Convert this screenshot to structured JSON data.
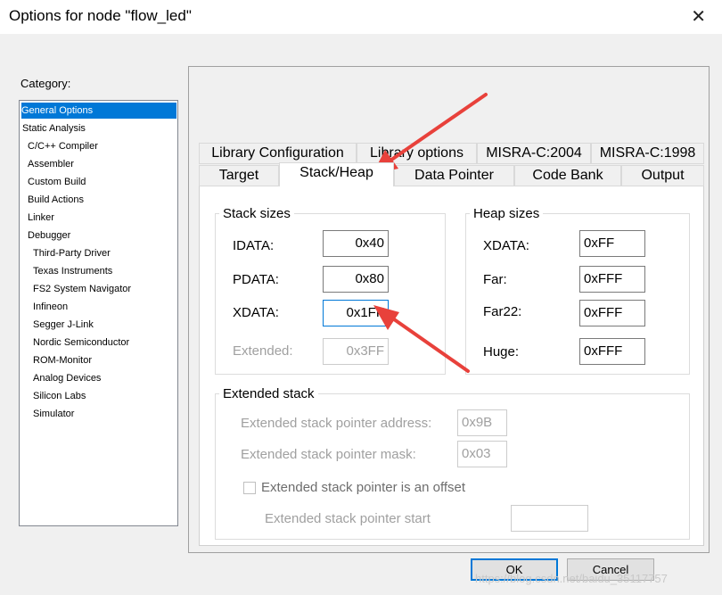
{
  "window": {
    "title": "Options for node \"flow_led\"",
    "close_glyph": "✕"
  },
  "category": {
    "label": "Category:",
    "items": [
      "General Options",
      "Static Analysis",
      "C/C++ Compiler",
      "Assembler",
      "Custom Build",
      "Build Actions",
      "Linker",
      "Debugger",
      "Third-Party Driver",
      "Texas Instruments",
      "FS2 System Navigator",
      "Infineon",
      "Segger J-Link",
      "Nordic Semiconductor",
      "ROM-Monitor",
      "Analog Devices",
      "Silicon Labs",
      "Simulator"
    ],
    "selected": "General Options"
  },
  "tabs": {
    "row1": [
      "Library Configuration",
      "Library options",
      "MISRA-C:2004",
      "MISRA-C:1998"
    ],
    "row2": [
      "Target",
      "Stack/Heap",
      "Data Pointer",
      "Code Bank",
      "Output"
    ],
    "active": "Stack/Heap"
  },
  "stack": {
    "title": "Stack sizes",
    "idata_label": "IDATA:",
    "idata_value": "0x40",
    "pdata_label": "PDATA:",
    "pdata_value": "0x80",
    "xdata_label": "XDATA:",
    "xdata_value": "0x1FF",
    "extended_label": "Extended:",
    "extended_value": "0x3FF"
  },
  "heap": {
    "title": "Heap sizes",
    "xdata_label": "XDATA:",
    "xdata_value": "0xFF",
    "far_label": "Far:",
    "far_value": "0xFFF",
    "far22_label": "Far22:",
    "far22_value": "0xFFF",
    "huge_label": "Huge:",
    "huge_value": "0xFFF"
  },
  "extended_stack": {
    "title": "Extended stack",
    "address_label": "Extended stack pointer address:",
    "address_value": "0x9B",
    "mask_label": "Extended stack pointer mask:",
    "mask_value": "0x03",
    "offset_label": "Extended stack pointer is an offset",
    "offset_checked": false,
    "start_label": "Extended stack pointer start",
    "start_value": ""
  },
  "buttons": {
    "ok": "OK",
    "cancel": "Cancel"
  },
  "watermark": "https://blog.csdn.net/baidu_35117757",
  "colors": {
    "selection": "#0078d7",
    "annotation_arrow": "#e8413b"
  }
}
